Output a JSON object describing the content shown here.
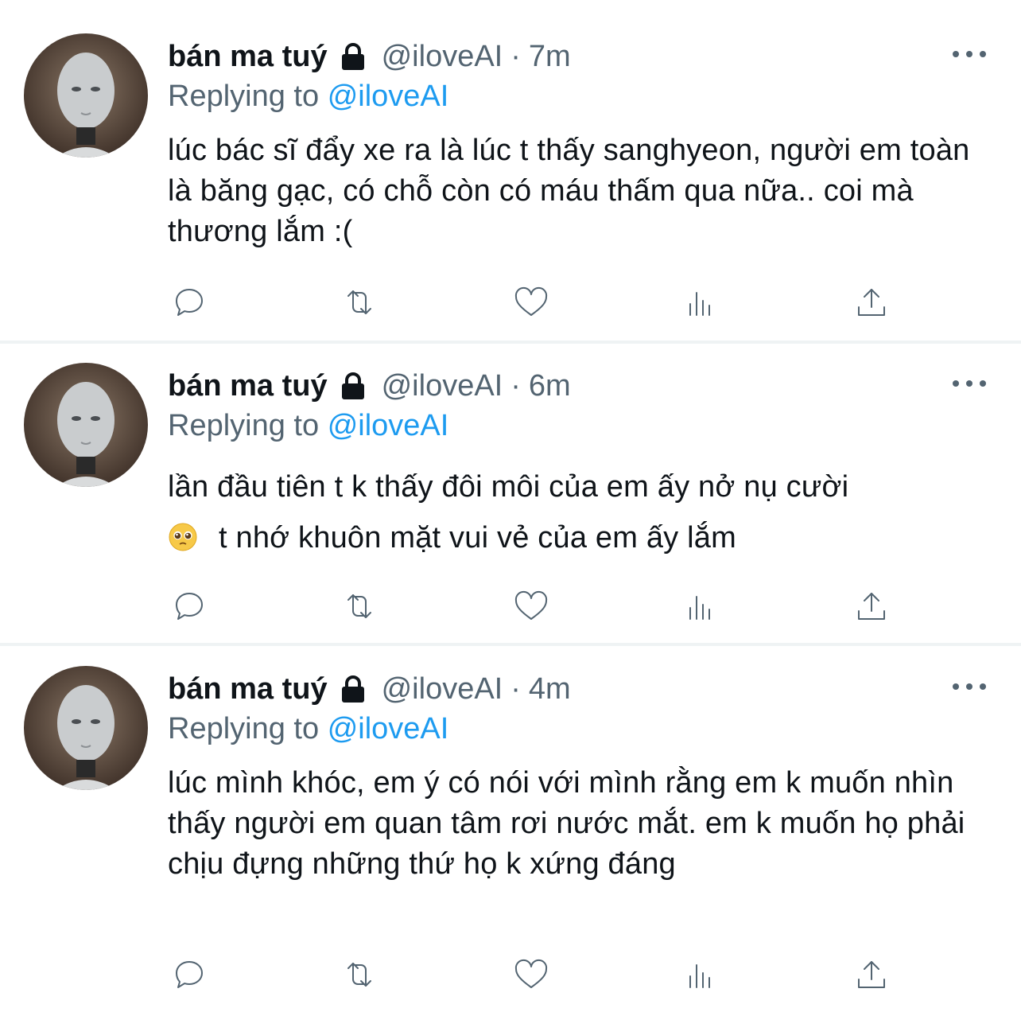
{
  "tweets": [
    {
      "name": "bán ma tuý",
      "handle": "@iloveAI",
      "separator": "·",
      "time": "7m",
      "replying_prefix": "Replying to",
      "replying_to": "@iloveAI",
      "text": "lúc bác sĩ đẩy xe ra là lúc t thấy sanghyeon, người em toàn là băng gạc, có chỗ còn có máu thấm qua nữa.. coi mà thương lắm :("
    },
    {
      "name": "bán ma tuý",
      "handle": "@iloveAI",
      "separator": "·",
      "time": "6m",
      "replying_prefix": "Replying to",
      "replying_to": "@iloveAI",
      "text_line1": "lần đầu tiên t k thấy đôi môi của em ấy nở nụ cười",
      "emoji": "pleading-face-emoji",
      "text_line2": "t nhớ khuôn mặt vui vẻ của em ấy lắm"
    },
    {
      "name": "bán ma tuý",
      "handle": "@iloveAI",
      "separator": "·",
      "time": "4m",
      "replying_prefix": "Replying to",
      "replying_to": "@iloveAI",
      "text": "lúc mình khóc, em ý có nói với mình rằng em k muốn nhìn thấy người em quan tâm rơi nước mắt. em k muốn họ phải chịu đựng những thứ họ k xứng đáng"
    }
  ],
  "icons": {
    "lock": "lock-icon",
    "more": "more-icon",
    "reply": "reply-icon",
    "retweet": "retweet-icon",
    "like": "like-icon",
    "views": "views-icon",
    "share": "share-icon"
  },
  "colors": {
    "text": "#0f1419",
    "secondary": "#536471",
    "mention": "#1d9bf0",
    "divider": "#eff3f4"
  }
}
